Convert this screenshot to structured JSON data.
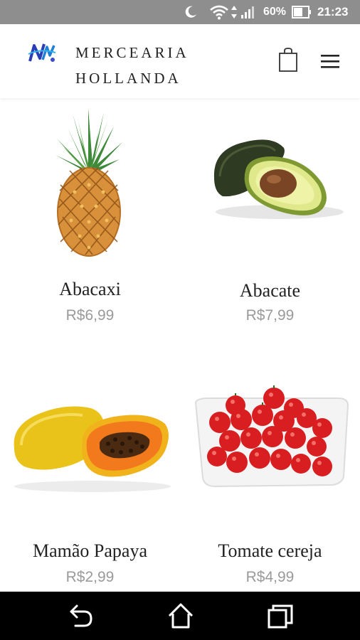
{
  "status_bar": {
    "battery_percent": "60%",
    "time": "21:23",
    "icons": [
      "moon-icon",
      "wifi-icon",
      "data-arrows-icon",
      "signal-icon",
      "battery-icon"
    ]
  },
  "header": {
    "brand_line1": "MERCEARIA",
    "brand_line2": "HOLLANDA",
    "icons": [
      "logo-icon",
      "shopping-bag-icon",
      "hamburger-menu-icon"
    ]
  },
  "products": [
    {
      "name": "Abacaxi",
      "price": "R$6,99",
      "image": "pineapple"
    },
    {
      "name": "Abacate",
      "price": "R$7,99",
      "image": "avocado"
    },
    {
      "name": "Mamão Papaya",
      "price": "R$2,99",
      "image": "papaya"
    },
    {
      "name": "Tomate cereja",
      "price": "R$4,99",
      "image": "cherry-tomatoes"
    }
  ],
  "nav_bar": {
    "icons": [
      "back-icon",
      "home-icon",
      "recent-apps-icon"
    ]
  },
  "colors": {
    "status_bar": "#8e8e8e",
    "price_text": "#9a9a9a",
    "nav_bar": "#000000"
  }
}
